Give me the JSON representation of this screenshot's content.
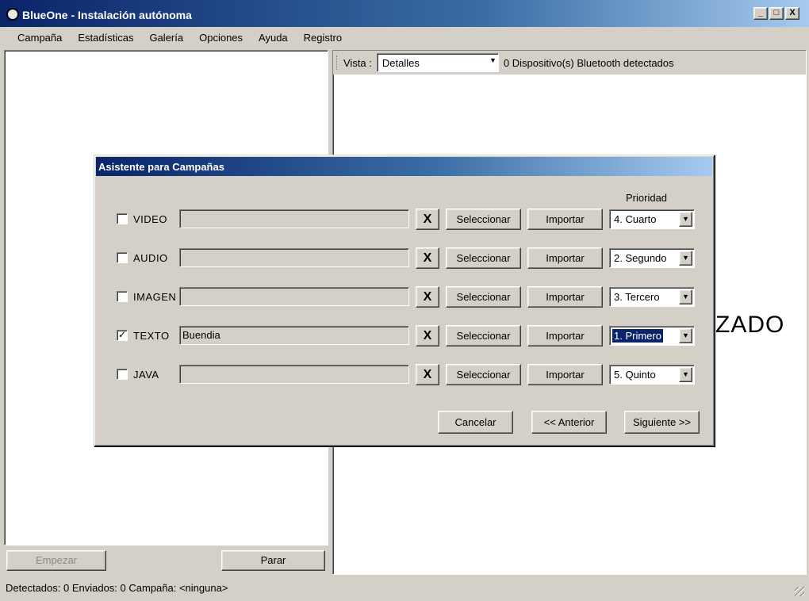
{
  "window": {
    "title": "BlueOne - Instalación autónoma",
    "controls": [
      "_",
      "□",
      "X"
    ]
  },
  "menu": [
    "Campaña",
    "Estadísticas",
    "Galería",
    "Opciones",
    "Ayuda",
    "Registro"
  ],
  "left_panel": {
    "start_label": "Empezar",
    "stop_label": "Parar"
  },
  "right_panel": {
    "vista_label": "Vista :",
    "vista_value": "Detalles",
    "devices_text": "0 Dispositivo(s) Bluetooth detectados",
    "background_text": "ZADO"
  },
  "status": {
    "text": "Detectados:  0  Enviados:  0  Campaña:  <ninguna>"
  },
  "dialog": {
    "title": "Asistente para Campañas",
    "prioridad_label": "Prioridad",
    "rows": [
      {
        "label": "VIDEO",
        "checked": false,
        "check_mark": "",
        "value": "",
        "clear": "X",
        "select": "Seleccionar",
        "import": "Importar",
        "priority": "4. Cuarto",
        "priority_focused": false
      },
      {
        "label": "AUDIO",
        "checked": false,
        "check_mark": "",
        "value": "",
        "clear": "X",
        "select": "Seleccionar",
        "import": "Importar",
        "priority": "2. Segundo",
        "priority_focused": false
      },
      {
        "label": "IMAGEN",
        "checked": false,
        "check_mark": "",
        "value": "",
        "clear": "X",
        "select": "Seleccionar",
        "import": "Importar",
        "priority": "3. Tercero",
        "priority_focused": false
      },
      {
        "label": "TEXTO",
        "checked": true,
        "check_mark": "✓",
        "value": "Buendia",
        "clear": "X",
        "select": "Seleccionar",
        "import": "Importar",
        "priority": "1. Primero",
        "priority_focused": true
      },
      {
        "label": "JAVA",
        "checked": false,
        "check_mark": "",
        "value": "",
        "clear": "X",
        "select": "Seleccionar",
        "import": "Importar",
        "priority": "5. Quinto",
        "priority_focused": false
      }
    ],
    "buttons": {
      "cancel": "Cancelar",
      "back": "<< Anterior",
      "next": "Siguiente >>"
    }
  },
  "colors": {
    "titlebar_active": "#0a246a",
    "face": "#d4d0c8",
    "selection": "#0a246a"
  }
}
